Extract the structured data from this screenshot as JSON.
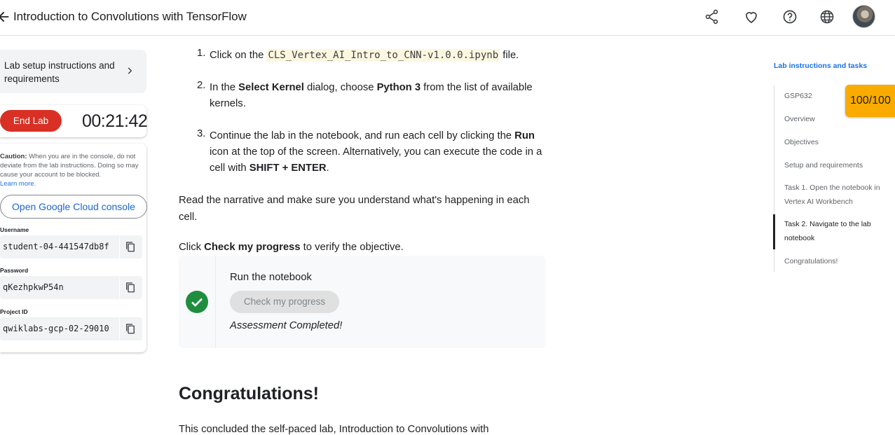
{
  "header": {
    "title": "Introduction to Convolutions with TensorFlow"
  },
  "sidebar": {
    "setup_label": "Lab setup instructions and requirements",
    "end_lab_label": "End Lab",
    "timer": "00:21:42",
    "caution_label": "Caution:",
    "caution_text": "When you are in the console, do not deviate from the lab instructions. Doing so may cause your account to be blocked.",
    "learn_more": "Learn more.",
    "console_button": "Open Google Cloud console",
    "credentials": [
      {
        "label": "Username",
        "value": "student-04-441547db8f"
      },
      {
        "label": "Password",
        "value": "qKezhpkwP54n"
      },
      {
        "label": "Project ID",
        "value": "qwiklabs-gcp-02-29010"
      }
    ]
  },
  "content": {
    "steps": [
      {
        "num": "1.",
        "pre": "Click on the ",
        "code": "CLS_Vertex_AI_Intro_to_CNN-v1.0.0.ipynb",
        "post": " file."
      },
      {
        "num": "2.",
        "pre": "In the ",
        "b1": "Select Kernel",
        "mid": " dialog, choose ",
        "b2": "Python 3",
        "post": " from the list of available kernels."
      },
      {
        "num": "3.",
        "pre": "Continue the lab in the notebook, and run each cell by clicking the ",
        "b1": "Run",
        "mid": " icon at the top of the screen. Alternatively, you can execute the code in a cell with ",
        "b2": "SHIFT + ENTER",
        "post": "."
      }
    ],
    "narrative": "Read the narrative and make sure you understand what's happening in each cell.",
    "verify_pre": "Click ",
    "verify_bold": "Check my progress",
    "verify_post": " to verify the objective.",
    "progress": {
      "title": "Run the notebook",
      "button": "Check my progress",
      "status": "Assessment Completed!"
    },
    "congrats_heading": "Congratulations!",
    "concluded_text": "This concluded the self-paced lab, Introduction to Convolutions with"
  },
  "toc": {
    "title": "Lab instructions and tasks",
    "items": [
      "GSP632",
      "Overview",
      "Objectives",
      "Setup and requirements",
      "Task 1. Open the notebook in Vertex AI Workbench",
      "Task 2. Navigate to the lab notebook",
      "Congratulations!"
    ],
    "score": "100/100"
  },
  "colors": {
    "accent": "#1a73e8",
    "end_lab": "#d93025",
    "success": "#1e8e3e",
    "score_badge": "#f9ab00"
  }
}
